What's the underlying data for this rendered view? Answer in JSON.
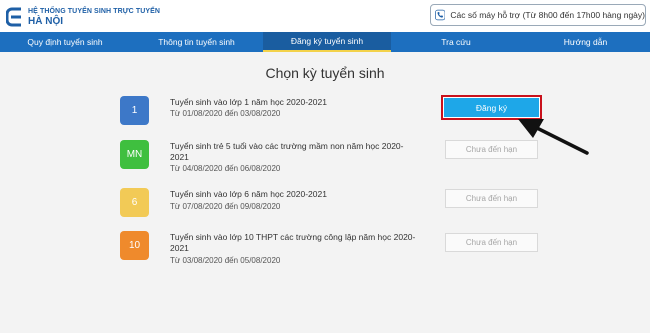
{
  "header": {
    "logo_line1": "HỆ THỐNG TUYỂN SINH TRỰC TUYẾN",
    "logo_line2": "HÀ NỘI",
    "hotline_text": "Các số máy hỗ trợ (Từ 8h00 đến 17h00 hàng ngày)",
    "hotline_icon": "phone-icon"
  },
  "nav": {
    "items": [
      {
        "label": "Quy định tuyển sinh"
      },
      {
        "label": "Thông tin tuyển sinh"
      },
      {
        "label": "Đăng ký tuyển sinh"
      },
      {
        "label": "Tra cứu"
      },
      {
        "label": "Hướng dẫn"
      }
    ],
    "active_index": 2
  },
  "main": {
    "heading": "Chọn kỳ tuyển sinh",
    "periods": [
      {
        "badge": "1",
        "badge_color": "#3d78c8",
        "title": "Tuyển sinh vào lớp 1 năm học 2020-2021",
        "date": "Từ 01/08/2020 đến 03/08/2020",
        "action": "Đăng ký",
        "enabled": true
      },
      {
        "badge": "MN",
        "badge_color": "#3fbf3f",
        "title": "Tuyển sinh trẻ 5 tuổi vào các trường mầm non năm học 2020-2021",
        "date": "Từ 04/08/2020 đến 06/08/2020",
        "action": "Chưa đến hạn",
        "enabled": false
      },
      {
        "badge": "6",
        "badge_color": "#f2ca56",
        "title": "Tuyển sinh vào lớp 6 năm học 2020-2021",
        "date": "Từ 07/08/2020 đến 09/08/2020",
        "action": "Chưa đến hạn",
        "enabled": false
      },
      {
        "badge": "10",
        "badge_color": "#ef8a2c",
        "title": "Tuyển sinh vào lớp 10 THPT các trường công lập năm học 2020-2021",
        "date": "Từ 03/08/2020 đến 05/08/2020",
        "action": "Chưa đến hạn",
        "enabled": false
      }
    ]
  },
  "colors": {
    "brand_blue": "#1d6fbf",
    "register_button": "#1ea7e8",
    "highlight_border": "#c9111b"
  }
}
